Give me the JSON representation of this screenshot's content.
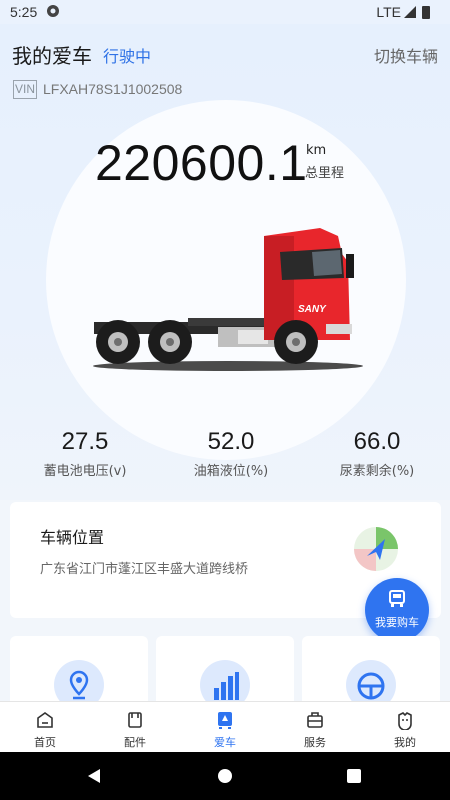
{
  "status_bar": {
    "time": "5:25",
    "network": "LTE"
  },
  "header": {
    "title": "我的爱车",
    "status": "行驶中",
    "switch_label": "切换车辆"
  },
  "vin": {
    "tag": "VIN",
    "value": "LFXAH78S1J1002508"
  },
  "mileage": {
    "value": "220600.1",
    "unit": "km",
    "label": "总里程"
  },
  "stats": [
    {
      "value": "27.5",
      "label": "蓄电池电压(v)"
    },
    {
      "value": "52.0",
      "label": "油箱液位(%)"
    },
    {
      "value": "66.0",
      "label": "尿素剩余(%)"
    }
  ],
  "location": {
    "title": "车辆位置",
    "address": "广东省江门市蓬江区丰盛大道跨线桥"
  },
  "buy_button": {
    "label": "我要购车"
  },
  "bottom_nav": [
    {
      "label": "首页",
      "icon": "home-icon"
    },
    {
      "label": "配件",
      "icon": "parts-icon"
    },
    {
      "label": "爱车",
      "icon": "car-icon"
    },
    {
      "label": "服务",
      "icon": "service-icon"
    },
    {
      "label": "我的",
      "icon": "profile-icon"
    }
  ],
  "colors": {
    "accent": "#2f74f0",
    "status": "#2f72e6",
    "truck": "#e8262c"
  }
}
